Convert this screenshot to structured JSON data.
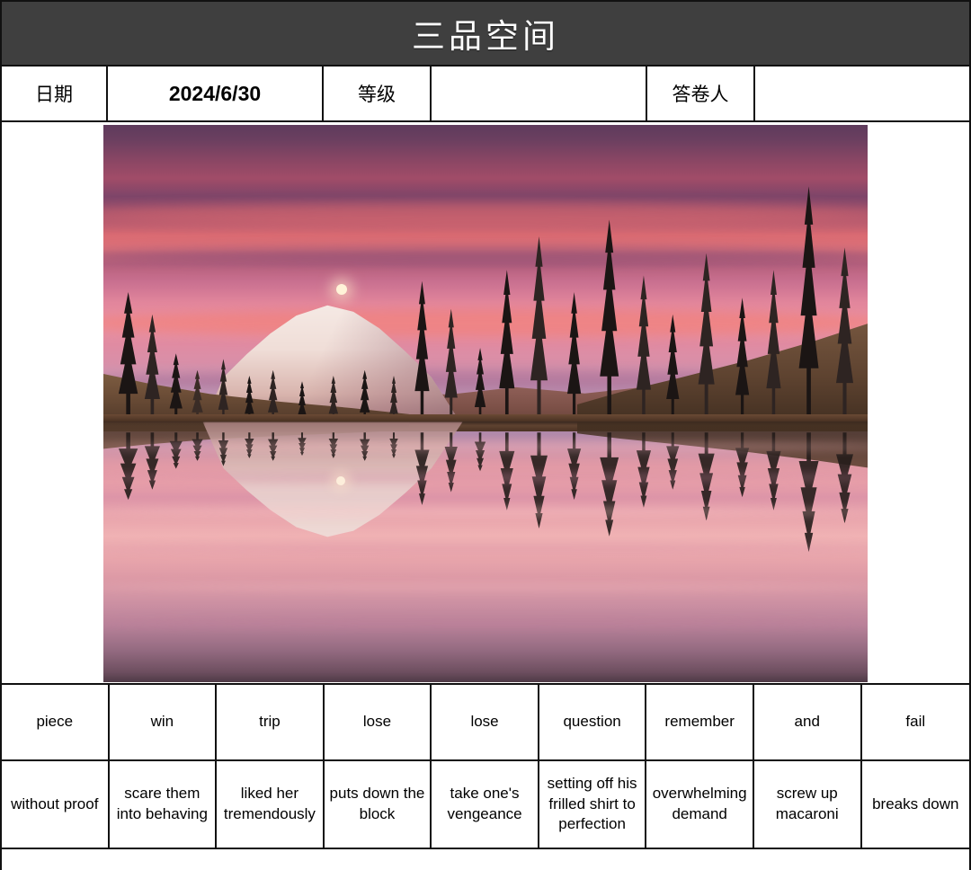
{
  "header": {
    "title": "三品空间",
    "title_bg": "#3f3f3f",
    "title_color": "#ffffff"
  },
  "meta": {
    "date_label": "日期",
    "date_value": "2024/6/30",
    "level_label": "等级",
    "level_value": "",
    "respondent_label": "答卷人",
    "respondent_value": ""
  },
  "picture": {
    "alt": "Sunset over a mountain lake with snow-capped peak and evergreen trees mirrored in still water",
    "scene": "mountain-lake-sunset"
  },
  "table": {
    "rows": [
      {
        "name": "words",
        "cells": [
          "piece",
          "win",
          "trip",
          "lose",
          "lose",
          "question",
          "remember",
          "and",
          "fail"
        ]
      },
      {
        "name": "phrases",
        "cells": [
          "without proof",
          "scare them into behaving",
          "liked her tremendously",
          "puts down the block",
          "take one's vengeance",
          "setting off his frilled shirt to perfection",
          "overwhelming demand",
          "screw up macaroni",
          "breaks down"
        ]
      }
    ]
  }
}
